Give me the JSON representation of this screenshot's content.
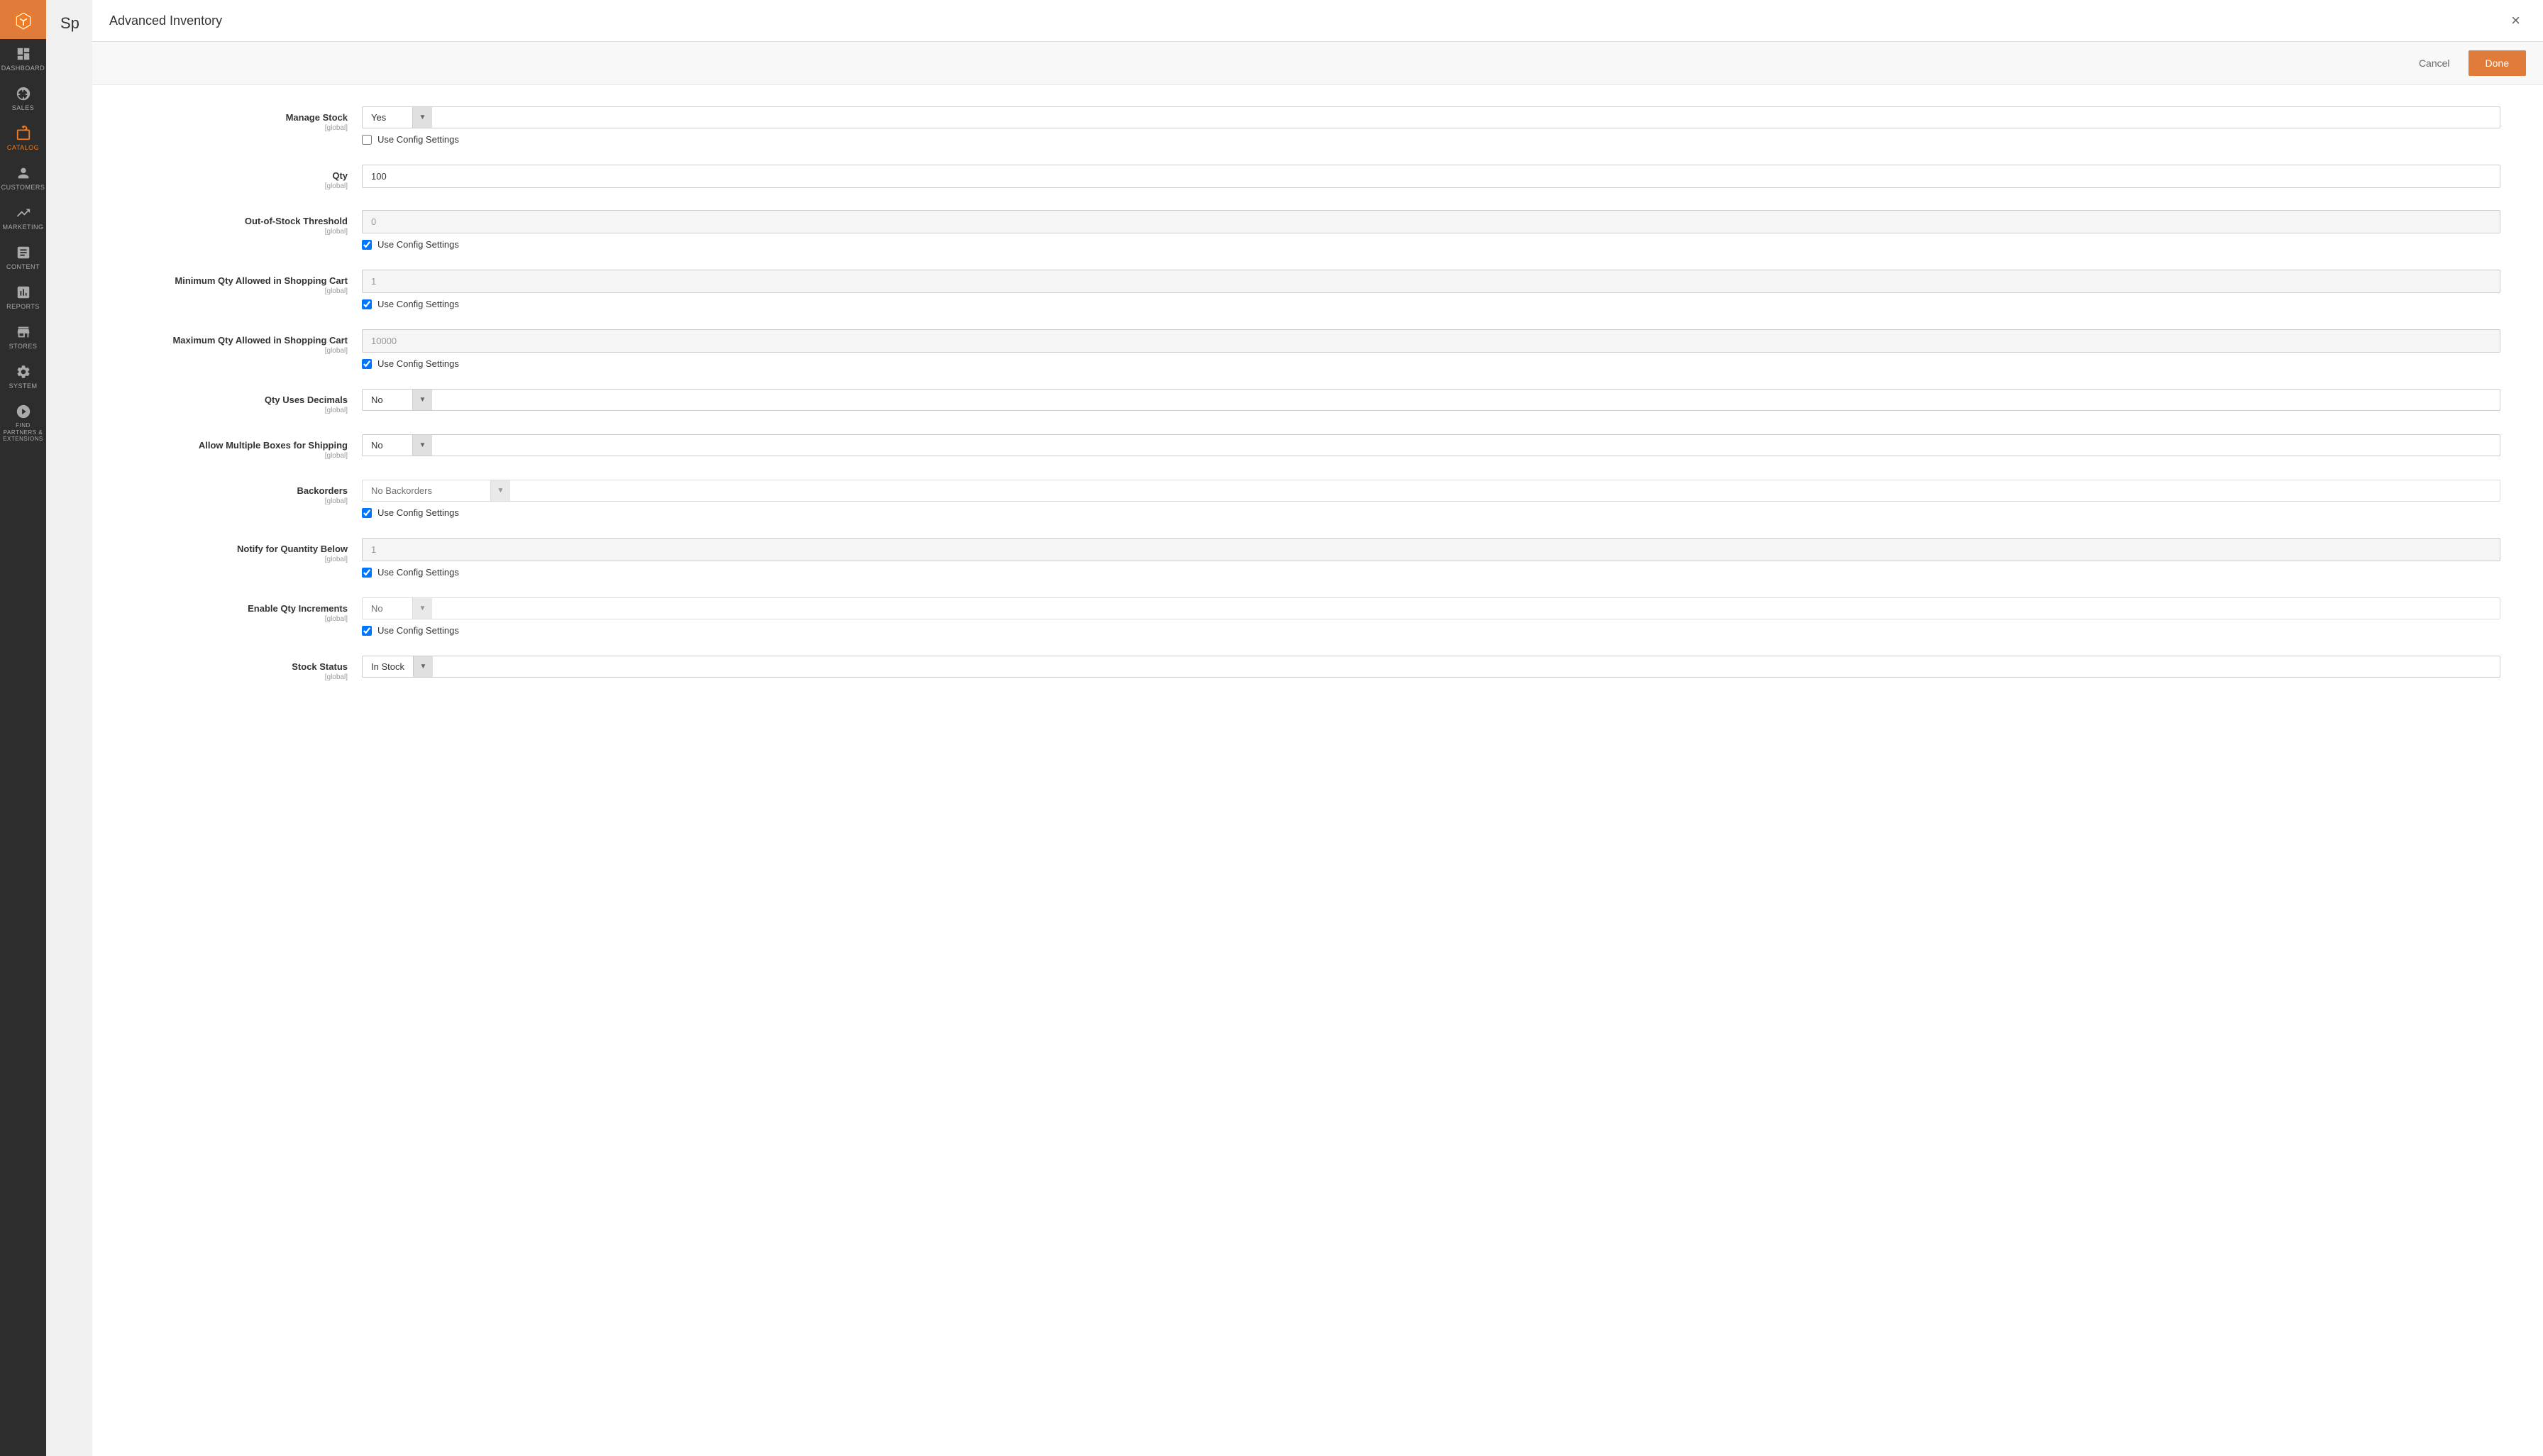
{
  "sidebar": {
    "logo_alt": "Magento",
    "items": [
      {
        "id": "dashboard",
        "label": "DASHBOARD",
        "icon": "dashboard"
      },
      {
        "id": "sales",
        "label": "SALES",
        "icon": "sales"
      },
      {
        "id": "catalog",
        "label": "CATALOG",
        "icon": "catalog",
        "active": true
      },
      {
        "id": "customers",
        "label": "CUSTOMERS",
        "icon": "customers"
      },
      {
        "id": "marketing",
        "label": "MARKETING",
        "icon": "marketing"
      },
      {
        "id": "content",
        "label": "CONTENT",
        "icon": "content"
      },
      {
        "id": "reports",
        "label": "REPORTS",
        "icon": "reports"
      },
      {
        "id": "stores",
        "label": "STORES",
        "icon": "stores"
      },
      {
        "id": "system",
        "label": "SYSTEM",
        "icon": "system"
      },
      {
        "id": "find-partners",
        "label": "FIND PARTNERS & EXTENSIONS",
        "icon": "partners"
      }
    ]
  },
  "modal": {
    "title": "Advanced Inventory",
    "close_label": "×",
    "cancel_label": "Cancel",
    "done_label": "Done",
    "fields": {
      "manage_stock": {
        "label": "Manage Stock",
        "scope": "[global]",
        "type": "select",
        "value": "Yes",
        "use_config": false,
        "use_config_label": "Use Config Settings"
      },
      "qty": {
        "label": "Qty",
        "scope": "[global]",
        "type": "input",
        "value": "100",
        "use_config": false
      },
      "out_of_stock_threshold": {
        "label": "Out-of-Stock Threshold",
        "scope": "[global]",
        "type": "input",
        "value": "0",
        "disabled": true,
        "use_config": true,
        "use_config_label": "Use Config Settings"
      },
      "min_qty_cart": {
        "label": "Minimum Qty Allowed in Shopping Cart",
        "scope": "[global]",
        "type": "input",
        "value": "1",
        "disabled": true,
        "use_config": true,
        "use_config_label": "Use Config Settings"
      },
      "max_qty_cart": {
        "label": "Maximum Qty Allowed in Shopping Cart",
        "scope": "[global]",
        "type": "input",
        "value": "10000",
        "disabled": true,
        "use_config": true,
        "use_config_label": "Use Config Settings"
      },
      "qty_uses_decimals": {
        "label": "Qty Uses Decimals",
        "scope": "[global]",
        "type": "select",
        "value": "No",
        "use_config": false
      },
      "allow_multiple_boxes": {
        "label": "Allow Multiple Boxes for Shipping",
        "scope": "[global]",
        "type": "select",
        "value": "No",
        "use_config": false
      },
      "backorders": {
        "label": "Backorders",
        "scope": "[global]",
        "type": "select",
        "value": "No Backorders",
        "wide": true,
        "disabled": true,
        "use_config": true,
        "use_config_label": "Use Config Settings"
      },
      "notify_qty_below": {
        "label": "Notify for Quantity Below",
        "scope": "[global]",
        "type": "input",
        "value": "1",
        "disabled": true,
        "use_config": true,
        "use_config_label": "Use Config Settings"
      },
      "enable_qty_increments": {
        "label": "Enable Qty Increments",
        "scope": "[global]",
        "type": "select",
        "value": "No",
        "disabled": true,
        "use_config": true,
        "use_config_label": "Use Config Settings"
      },
      "stock_status": {
        "label": "Stock Status",
        "scope": "[global]",
        "type": "select",
        "value": "In Stock",
        "use_config": false
      }
    }
  }
}
